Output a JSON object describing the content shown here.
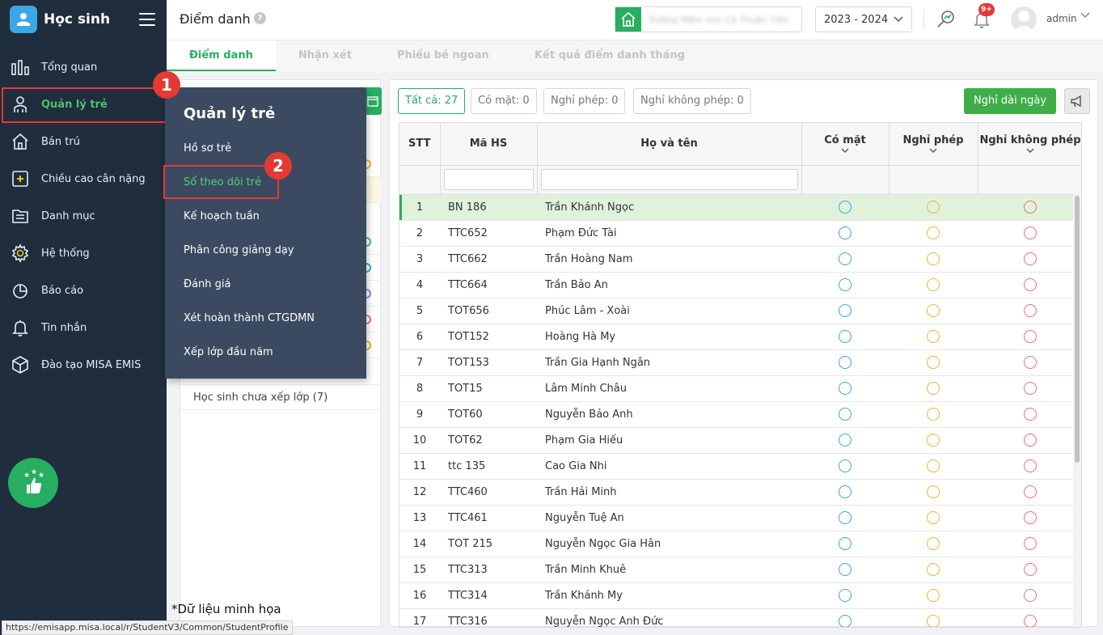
{
  "app": {
    "title": "Học sinh",
    "page_title": "Điểm danh",
    "help_label": "?",
    "school_name": "Trường Mầm non Cà Thuận Tiên",
    "school_year": "2023 - 2024",
    "notification_count": "9+",
    "user_name": "admin"
  },
  "sidebar": {
    "items": [
      {
        "label": "Tổng quan",
        "icon": "chart-bars-icon"
      },
      {
        "label": "Quản lý trẻ",
        "icon": "child-user-icon"
      },
      {
        "label": "Bán trú",
        "icon": "house-icon"
      },
      {
        "label": "Chiều cao cân nặng",
        "icon": "plus-square-icon"
      },
      {
        "label": "Danh mục",
        "icon": "folder-list-icon"
      },
      {
        "label": "Hệ thống",
        "icon": "gear-icon"
      },
      {
        "label": "Báo cáo",
        "icon": "pie-chart-icon"
      },
      {
        "label": "Tin nhắn",
        "icon": "bell-icon"
      },
      {
        "label": "Đào tạo MISA EMIS",
        "icon": "cube-icon"
      }
    ]
  },
  "callouts": {
    "one": "1",
    "two": "2"
  },
  "tabs": [
    "Điểm danh",
    "Nhận xét",
    "Phiếu bé ngoan",
    "Kết quả điểm danh tháng"
  ],
  "flyout": {
    "title": "Quản lý trẻ",
    "items": [
      "Hồ sơ trẻ",
      "Sổ theo dõi trẻ",
      "Kế hoạch tuần",
      "Phân công giảng dạy",
      "Đánh giá",
      "Xét hoàn thành CTGDMN",
      "Xếp lớp đầu năm"
    ]
  },
  "left_panel": {
    "unassigned_label": "Học sinh chưa xếp lớp (7)"
  },
  "filters": {
    "all": "Tất cả: 27",
    "present": "Có mặt: 0",
    "excused": "Nghỉ phép: 0",
    "unexcused": "Nghỉ không phép: 0",
    "long_leave_button": "Nghỉ dài ngày"
  },
  "table": {
    "headers": {
      "stt": "STT",
      "code": "Mã HS",
      "name": "Họ và tên",
      "present": "Có mặt",
      "excused": "Nghỉ phép",
      "unexcused": "Nghỉ không phép"
    },
    "rows": [
      {
        "stt": "1",
        "code": "BN 186",
        "name": "Trần Khánh Ngọc"
      },
      {
        "stt": "2",
        "code": "TTC652",
        "name": "Phạm Đức Tài"
      },
      {
        "stt": "3",
        "code": "TTC662",
        "name": "Trần Hoàng Nam"
      },
      {
        "stt": "4",
        "code": "TTC664",
        "name": "Trần Bảo An"
      },
      {
        "stt": "5",
        "code": "TOT656",
        "name": "Phúc Lâm - Xoài"
      },
      {
        "stt": "6",
        "code": "TOT152",
        "name": "Hoàng Hà My"
      },
      {
        "stt": "7",
        "code": "TOT153",
        "name": "Trần Gia Hạnh Ngân"
      },
      {
        "stt": "8",
        "code": "TOT15",
        "name": "Lâm Minh Châu"
      },
      {
        "stt": "9",
        "code": "TOT60",
        "name": "Nguyễn Bảo Anh"
      },
      {
        "stt": "10",
        "code": "TOT62",
        "name": "Phạm Gia Hiếu"
      },
      {
        "stt": "11",
        "code": "ttc 135",
        "name": "Cao Gia Nhi"
      },
      {
        "stt": "12",
        "code": "TTC460",
        "name": "Trần Hải Minh"
      },
      {
        "stt": "13",
        "code": "TTC461",
        "name": "Nguyễn Tuệ An"
      },
      {
        "stt": "14",
        "code": "TOT 215",
        "name": "Nguyễn Ngọc Gia Hân"
      },
      {
        "stt": "15",
        "code": "TTC313",
        "name": "Trần Minh Khuê"
      },
      {
        "stt": "16",
        "code": "TTC314",
        "name": "Trần Khánh My"
      },
      {
        "stt": "17",
        "code": "TTC316",
        "name": "Nguyễn Ngọc Anh Đức"
      }
    ]
  },
  "colors": {
    "accent": "#27ae60",
    "callout": "#e53935",
    "present_radio": "#3aa8d8",
    "excused_radio": "#f0b429",
    "unexcused_radio": "#e8707f"
  },
  "note": "*Dữ liệu minh họa",
  "status_url": "https://emisapp.misa.local/r/StudentV3/Common/StudentProfile"
}
